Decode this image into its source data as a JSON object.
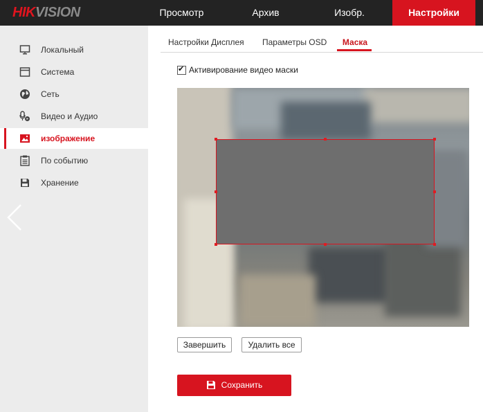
{
  "header": {
    "logo": {
      "hik": "HIK",
      "vision": "VISION"
    },
    "nav": [
      {
        "label": "Просмотр"
      },
      {
        "label": "Архив"
      },
      {
        "label": "Изобр."
      },
      {
        "label": "Настройки",
        "active": true
      }
    ]
  },
  "sidebar": {
    "items": [
      {
        "label": "Локальный",
        "icon": "monitor-icon"
      },
      {
        "label": "Система",
        "icon": "system-window-icon"
      },
      {
        "label": "Сеть",
        "icon": "network-globe-icon"
      },
      {
        "label": "Видео и Аудио",
        "icon": "video-audio-icon"
      },
      {
        "label": "изображение",
        "icon": "image-icon",
        "active": true
      },
      {
        "label": "По событию",
        "icon": "event-list-icon"
      },
      {
        "label": "Хранение",
        "icon": "storage-disk-icon"
      }
    ],
    "back_icon": "chevron-left-icon"
  },
  "tabs": [
    {
      "label": "Настройки Дисплея"
    },
    {
      "label": "Параметры OSD"
    },
    {
      "label": "Маска",
      "active": true
    }
  ],
  "mask": {
    "enable_label": "Активирование видео маски",
    "enabled": true
  },
  "buttons": {
    "finish": "Завершить",
    "delete_all": "Удалить все",
    "save": "Сохранить"
  },
  "colors": {
    "accent": "#d7141f",
    "topbar": "#232323",
    "sidebar": "#ececec",
    "mask_fill": "#6e6e6e"
  }
}
